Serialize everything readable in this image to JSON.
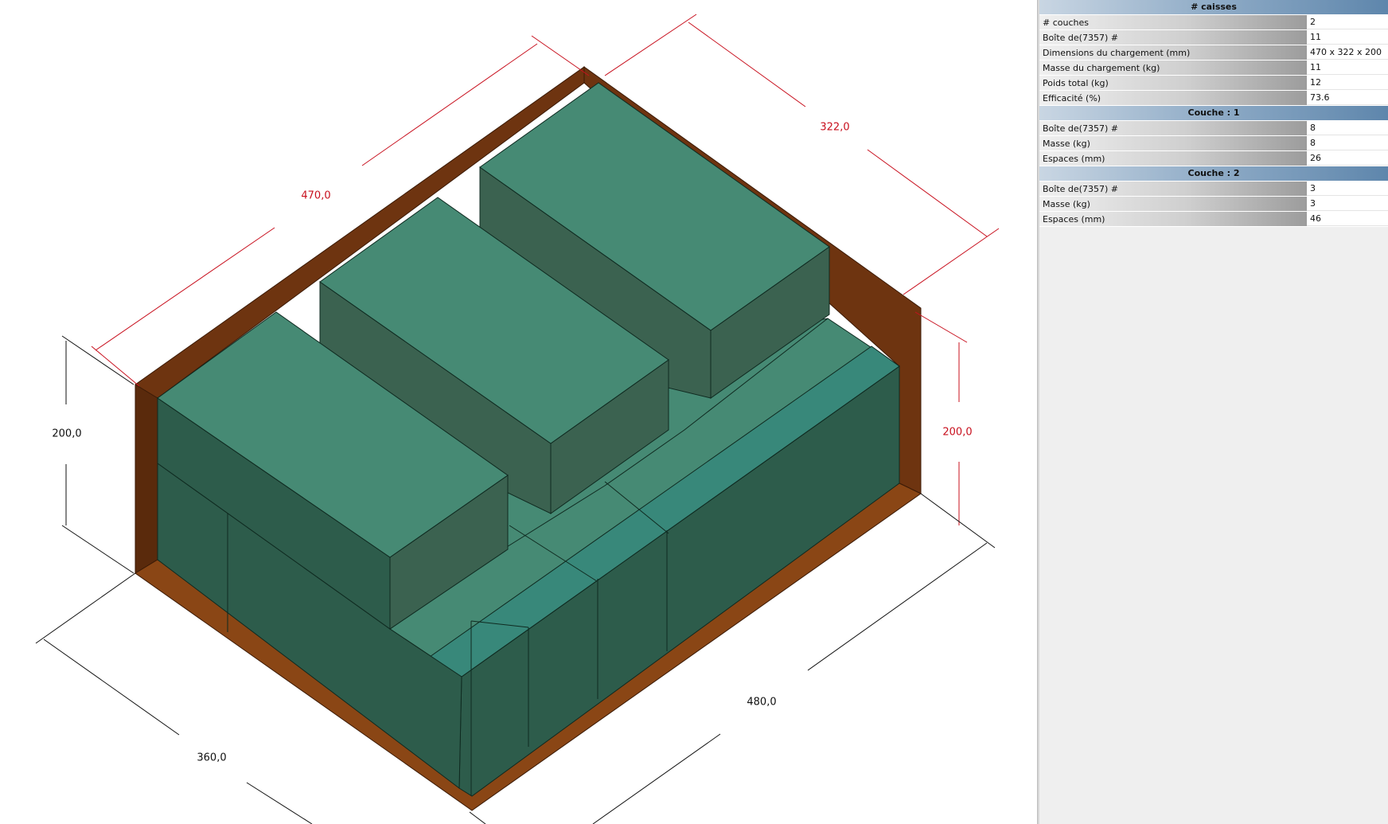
{
  "colors": {
    "container_dark": "#6e3410",
    "container_floor": "#8a4615",
    "box_top": "#468a74",
    "box_side_dark": "#2d5c4b",
    "box_side_mid": "#3b6250",
    "box_highlight": "#38887a",
    "dim_red": "#c8101e",
    "dim_black": "#111111"
  },
  "dimensions": {
    "load_length": "470,0",
    "load_width": "322,0",
    "load_height": "200,0",
    "container_length": "480,0",
    "container_width": "360,0",
    "container_height": "200,0"
  },
  "summary": {
    "header": "# caisses",
    "rows": [
      {
        "label": "# couches",
        "value": "2"
      },
      {
        "label": "Boîte de(7357) #",
        "value": "11"
      },
      {
        "label": "Dimensions du chargement (mm)",
        "value": "470 x 322 x 200"
      },
      {
        "label": "Masse du chargement (kg)",
        "value": "11"
      },
      {
        "label": "Poids total (kg)",
        "value": "12"
      },
      {
        "label": "Efficacité (%)",
        "value": "73.6"
      }
    ]
  },
  "layer1": {
    "header": "Couche : 1",
    "rows": [
      {
        "label": "Boîte de(7357) #",
        "value": "8"
      },
      {
        "label": "Masse (kg)",
        "value": "8"
      },
      {
        "label": "Espaces (mm)",
        "value": "26"
      }
    ]
  },
  "layer2": {
    "header": "Couche : 2",
    "rows": [
      {
        "label": "Boîte de(7357) #",
        "value": "3"
      },
      {
        "label": "Masse (kg)",
        "value": "3"
      },
      {
        "label": "Espaces (mm)",
        "value": "46"
      }
    ]
  }
}
